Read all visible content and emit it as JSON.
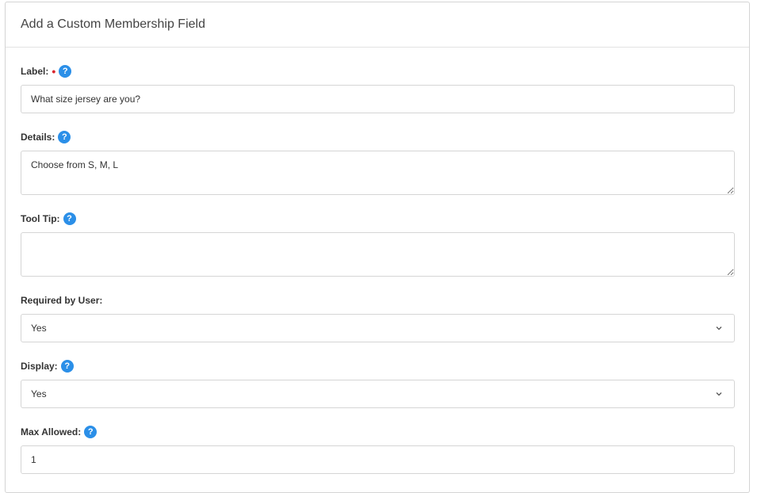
{
  "form": {
    "title": "Add a Custom Membership Field",
    "label_field": {
      "label": "Label:",
      "required_marker": "•",
      "value": "What size jersey are you?"
    },
    "details_field": {
      "label": "Details:",
      "value": "Choose from S, M, L"
    },
    "tooltip_field": {
      "label": "Tool Tip:",
      "value": ""
    },
    "required_field": {
      "label": "Required by User:",
      "selected": "Yes"
    },
    "display_field": {
      "label": "Display:",
      "selected": "Yes"
    },
    "max_allowed_field": {
      "label": "Max Allowed:",
      "value": "1"
    },
    "help_icon_glyph": "?"
  },
  "colors": {
    "help_icon": "#2b8fe8",
    "required_marker": "#d9262e",
    "border": "#d5d5d5"
  }
}
